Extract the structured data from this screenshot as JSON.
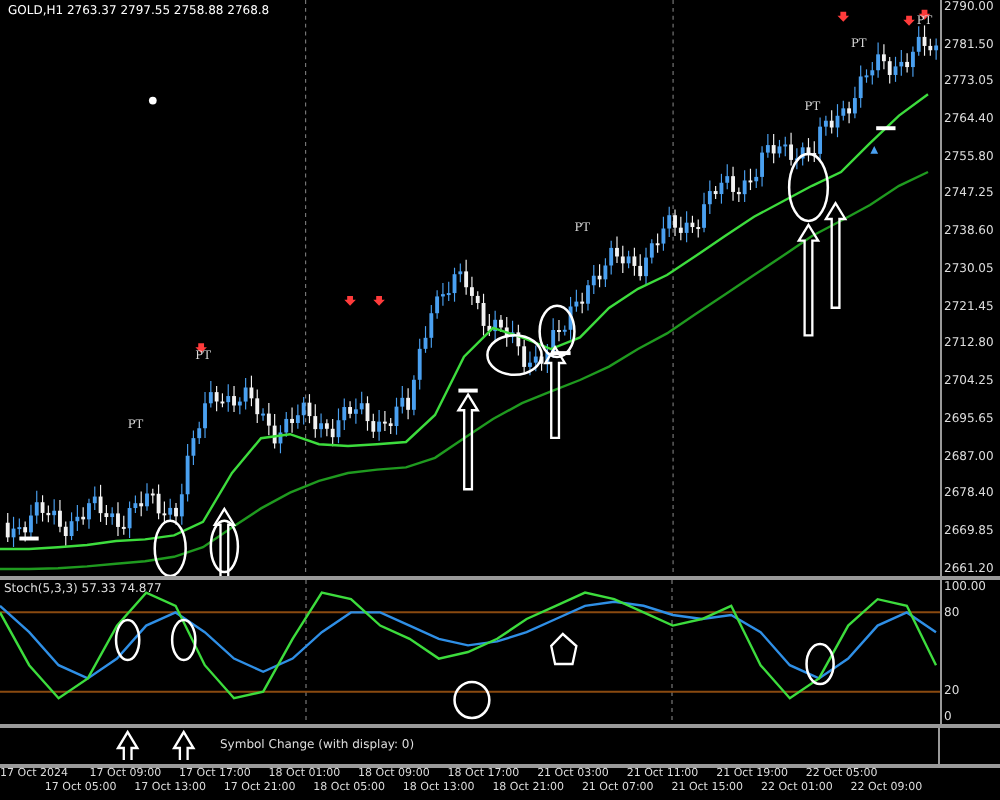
{
  "chart_title": "GOLD,H1  2763.37 2797.55 2758.88 2768.8",
  "pt_labels": [
    "PT",
    "PT",
    "PT",
    "PT",
    "PT",
    "PT"
  ],
  "price_chart": {
    "chart_data": {
      "type": "line",
      "ylim": [
        2659.6,
        2791.6
      ],
      "yticks": [
        {
          "value": 2790,
          "label": "2790.00"
        },
        {
          "value": 2781.5,
          "label": "2781.50"
        },
        {
          "value": 2773.05,
          "label": "2773.05"
        },
        {
          "value": 2764.4,
          "label": "2764.40"
        },
        {
          "value": 2755.8,
          "label": "2755.80"
        },
        {
          "value": 2747.25,
          "label": "2747.25"
        },
        {
          "value": 2738.6,
          "label": "2738.60"
        },
        {
          "value": 2730.05,
          "label": "2730.05"
        },
        {
          "value": 2721.45,
          "label": "2721.45"
        },
        {
          "value": 2712.8,
          "label": "2712.80"
        },
        {
          "value": 2704.25,
          "label": "2704.25"
        },
        {
          "value": 2695.65,
          "label": "2695.65"
        },
        {
          "value": 2687,
          "label": "2687.00"
        },
        {
          "value": 2678.4,
          "label": "2678.40"
        },
        {
          "value": 2669.85,
          "label": "2669.85"
        },
        {
          "value": 2661.2,
          "label": "2661.20"
        }
      ],
      "series": [
        {
          "color": "#3ddc3d",
          "values": [
            2665.8,
            2665.8,
            2666.2,
            2666.7,
            2667.6,
            2668.0,
            2668.9,
            2672.0,
            2683.2,
            2691.2,
            2692.1,
            2689.8,
            2689.4,
            2689.8,
            2690.3,
            2696.5,
            2709.9,
            2716.5,
            2714.3,
            2711.6,
            2714.3,
            2721.0,
            2725.4,
            2728.6,
            2733.0,
            2737.5,
            2741.9,
            2745.5,
            2749.0,
            2752.2,
            2758.8,
            2765.1,
            2770.0
          ]
        },
        {
          "color": "#1f9a1f",
          "values": [
            2661.2,
            2661.2,
            2661.4,
            2661.8,
            2662.4,
            2663.0,
            2664.0,
            2666.2,
            2670.7,
            2675.1,
            2678.7,
            2681.4,
            2683.2,
            2684.0,
            2684.5,
            2686.7,
            2691.2,
            2695.6,
            2699.2,
            2701.9,
            2704.5,
            2707.6,
            2711.6,
            2715.2,
            2719.7,
            2724.1,
            2728.6,
            2733.0,
            2737.5,
            2741.0,
            2744.6,
            2749.0,
            2752.2
          ]
        }
      ]
    }
  },
  "indicator": {
    "label": "Stoch(5,3,3) 57.33 74.877",
    "chart_data": {
      "type": "line",
      "ylim": [
        -4.5,
        104.5
      ],
      "yticks": [
        {
          "value": 100,
          "label": "100.00"
        },
        {
          "value": 80,
          "label": "80"
        },
        {
          "value": 20,
          "label": "20"
        },
        {
          "value": 0,
          "label": "0"
        }
      ],
      "series": [
        {
          "color": "#2f8fe6",
          "values": [
            85,
            65,
            40,
            30,
            45,
            70,
            80,
            65,
            45,
            35,
            45,
            65,
            80,
            80,
            70,
            60,
            55,
            58,
            65,
            75,
            85,
            88,
            85,
            78,
            75,
            78,
            65,
            40,
            30,
            45,
            70,
            80,
            65
          ]
        },
        {
          "color": "#3ddc3d",
          "values": [
            80,
            40,
            15,
            30,
            70,
            95,
            85,
            40,
            15,
            20,
            60,
            95,
            90,
            70,
            60,
            45,
            50,
            60,
            75,
            85,
            95,
            90,
            80,
            70,
            75,
            85,
            40,
            15,
            30,
            70,
            90,
            85,
            40
          ]
        }
      ]
    }
  },
  "sub_panel": {
    "label": "Symbol Change (with display: 0)"
  },
  "time_axis": [
    "17 Oct 2024",
    "17 Oct 05:00",
    "17 Oct 09:00",
    "17 Oct 13:00",
    "17 Oct 17:00",
    "17 Oct 21:00",
    "18 Oct 01:00",
    "18 Oct 05:00",
    "18 Oct 09:00",
    "18 Oct 13:00",
    "18 Oct 17:00",
    "18 Oct 21:00",
    "21 Oct 03:00",
    "21 Oct 07:00",
    "21 Oct 11:00",
    "21 Oct 15:00",
    "21 Oct 19:00",
    "22 Oct 01:00",
    "22 Oct 05:00",
    "22 Oct 09:00"
  ]
}
